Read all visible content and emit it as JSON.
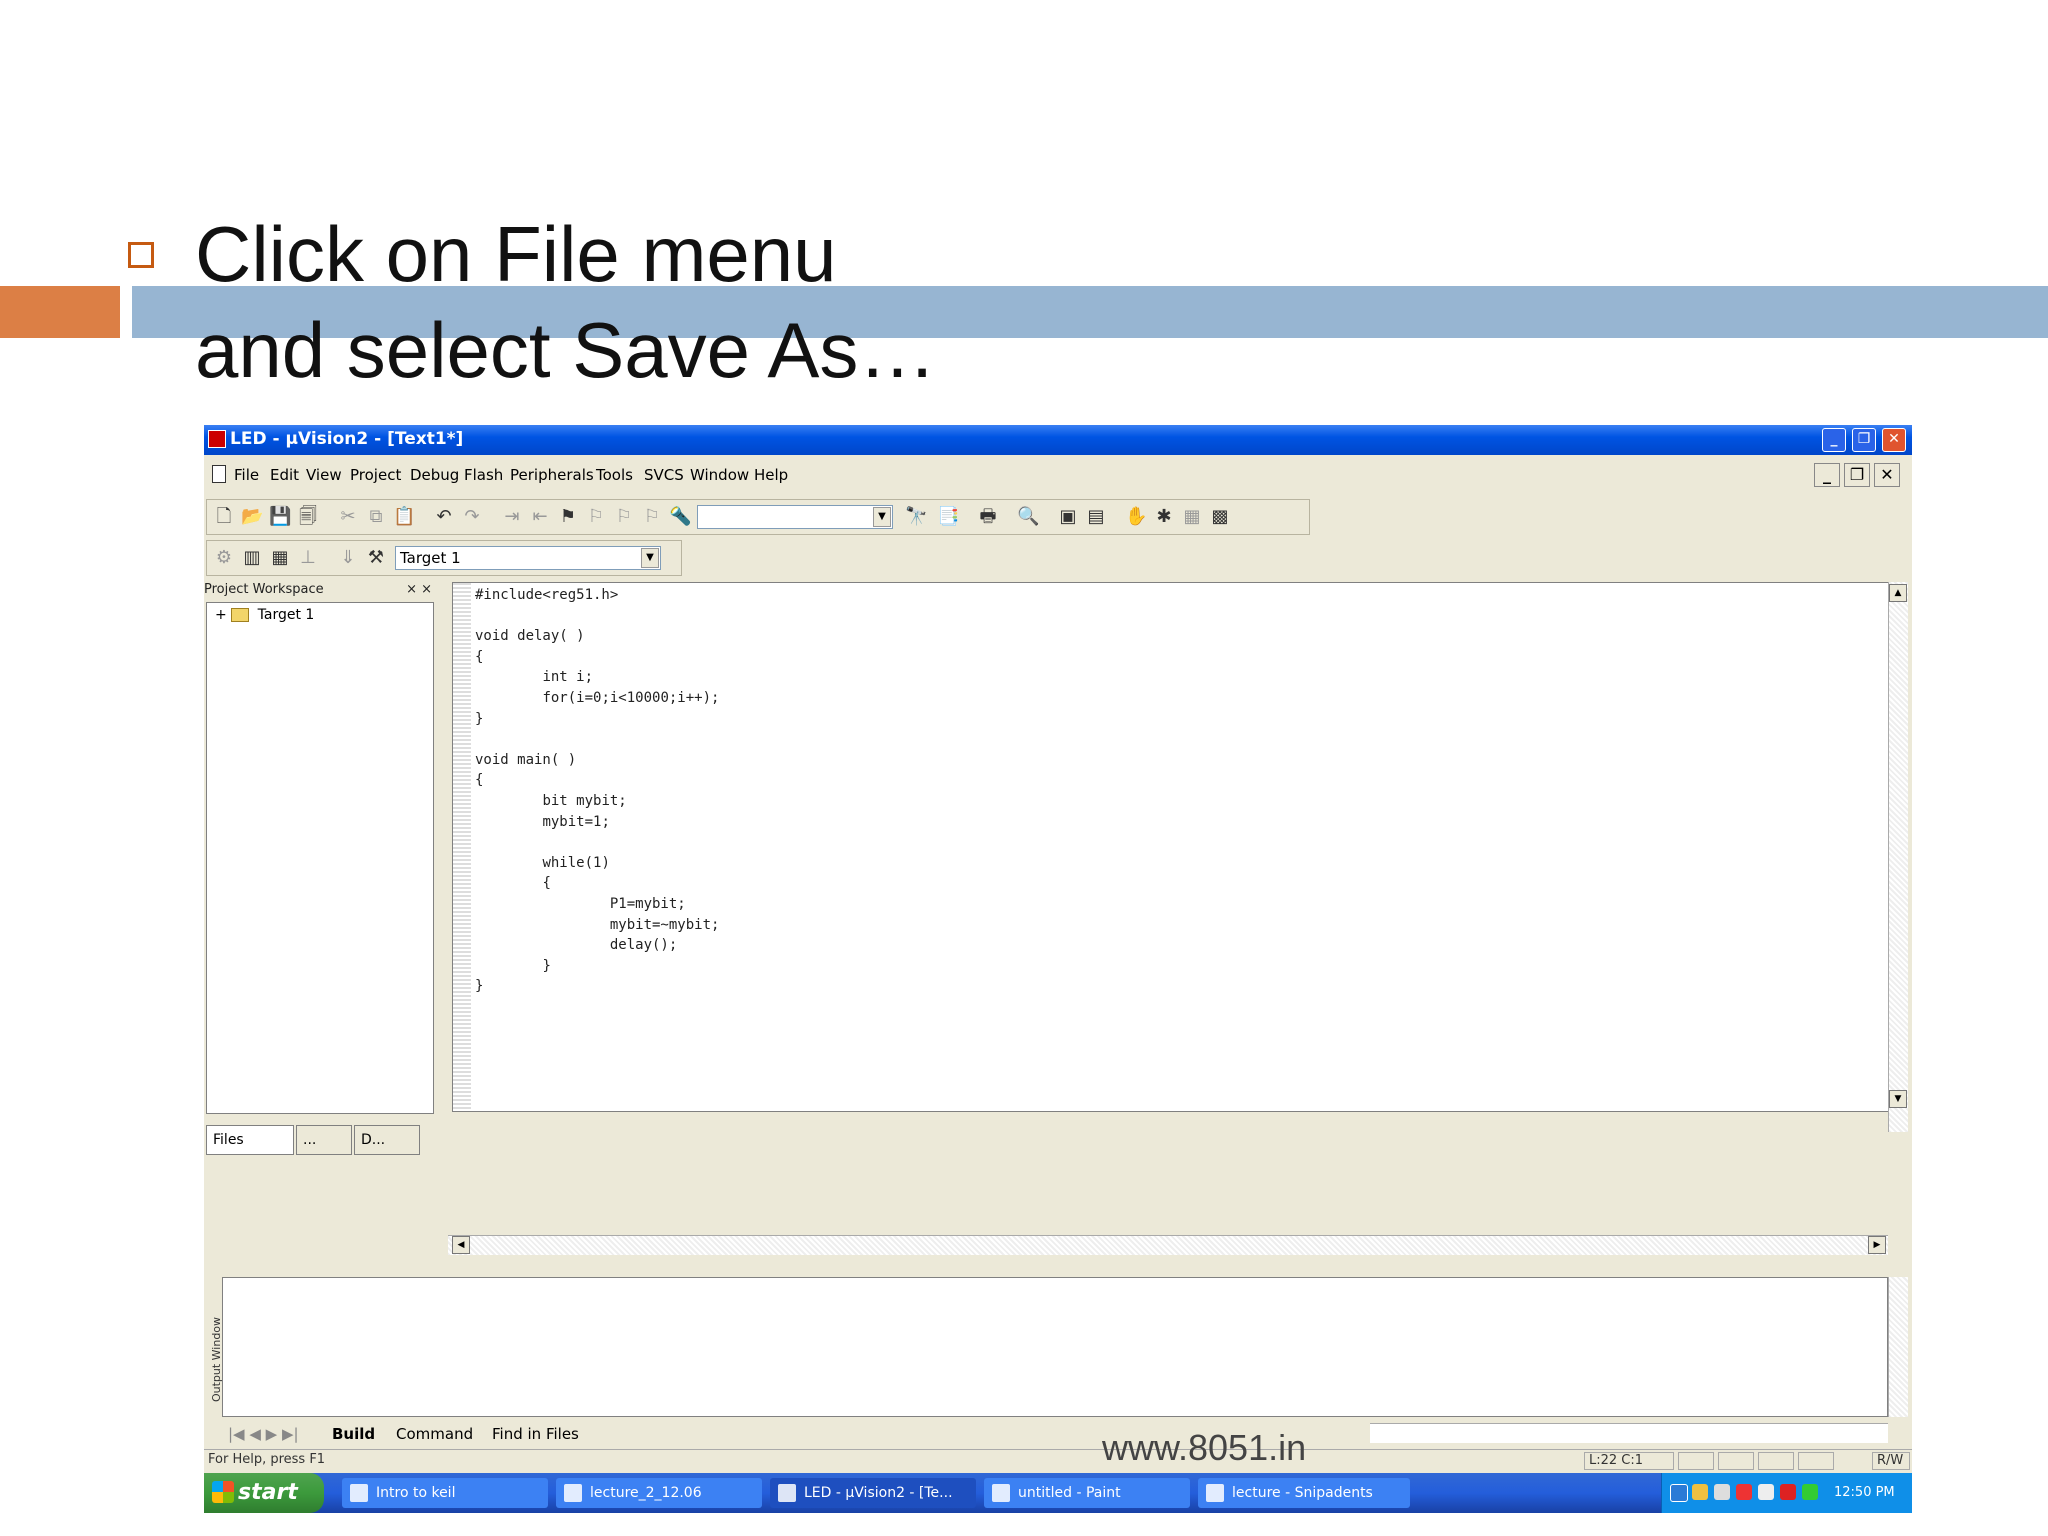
{
  "slide": {
    "title": "Click on File menu\nand select Save As…",
    "watermark": "www.8051.in",
    "colors": {
      "accent_orange": "#dc7f45",
      "accent_blue": "#97b5d2"
    }
  },
  "window": {
    "title": "LED - µVision2 - [Text1*]",
    "icon": "uvision-app-icon",
    "controls": [
      "minimize-icon",
      "restore-icon",
      "close-icon"
    ]
  },
  "menu": {
    "items": [
      "File",
      "Edit",
      "View",
      "Project",
      "Debug",
      "Flash",
      "Peripherals",
      "Tools",
      "SVCS",
      "Window",
      "Help"
    ]
  },
  "toolbar": {
    "find_combo_value": "",
    "target_combo_value": "Target 1"
  },
  "workspace": {
    "title": "Project Workspace",
    "tree": [
      {
        "label": "Target 1",
        "expander": "+"
      }
    ],
    "tabs": [
      "Files",
      "...",
      "D..."
    ]
  },
  "editor": {
    "code": "#include<reg51.h>\n\nvoid delay( )\n{\n\tint i;\n\tfor(i=0;i<10000;i++);\n}\n\nvoid main( )\n{\n\tbit mybit;\n\tmybit=1;\n\n\twhile(1)\n\t{\n\t\tP1=mybit;\n\t\tmybit=~mybit;\n\t\tdelay();\n\t}\n}"
  },
  "output": {
    "label": "Output Window",
    "tabs": [
      "Build",
      "Command",
      "Find in Files"
    ]
  },
  "status": {
    "help_text": "For Help, press F1",
    "position": "L:22 C:1",
    "mode": "R/W"
  },
  "taskbar": {
    "start_label": "start",
    "tasks": [
      {
        "label": "Intro to keil",
        "active": false
      },
      {
        "label": "lecture_2_12.06",
        "active": false
      },
      {
        "label": "LED - µVision2 - [Te...",
        "active": true
      },
      {
        "label": "untitled - Paint",
        "active": false
      },
      {
        "label": "lecture - Snipadents",
        "active": false
      }
    ],
    "clock": "12:50 PM"
  }
}
